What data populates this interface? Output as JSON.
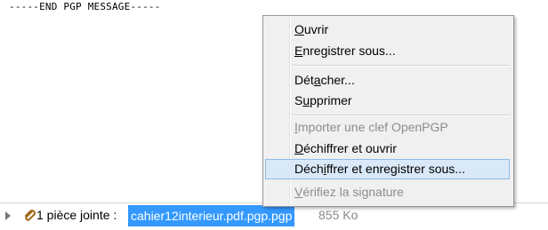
{
  "message": {
    "pgp_end_line": "-----END PGP MESSAGE-----"
  },
  "attachment_bar": {
    "count_label": "1 pièce jointe :",
    "file_name": "cahier12interieur.pdf.pgp.pgp",
    "file_size": "855 Ko"
  },
  "context_menu": {
    "items": [
      {
        "label": "Ouvrir",
        "mnemonic": "O",
        "enabled": true
      },
      {
        "label": "Enregistrer sous...",
        "mnemonic": "E",
        "enabled": true
      },
      {
        "label": "Détacher...",
        "mnemonic": "a",
        "enabled": true
      },
      {
        "label": "Supprimer",
        "mnemonic": "u",
        "enabled": true
      },
      {
        "label": "Importer une clef OpenPGP",
        "mnemonic": "I",
        "enabled": false
      },
      {
        "label": "Déchiffrer et ouvrir",
        "mnemonic": "D",
        "enabled": true
      },
      {
        "label": "Déchiffrer et enregistrer sous...",
        "mnemonic": "i",
        "enabled": true,
        "highlighted": true
      },
      {
        "label": "Vérifiez la signature",
        "mnemonic": "V",
        "enabled": false
      }
    ]
  },
  "colors": {
    "selection": "#3399ff",
    "menu_background": "#f0f0f0",
    "menu_hover": "#d9e9f8",
    "disabled_text": "#8d8d8d"
  }
}
